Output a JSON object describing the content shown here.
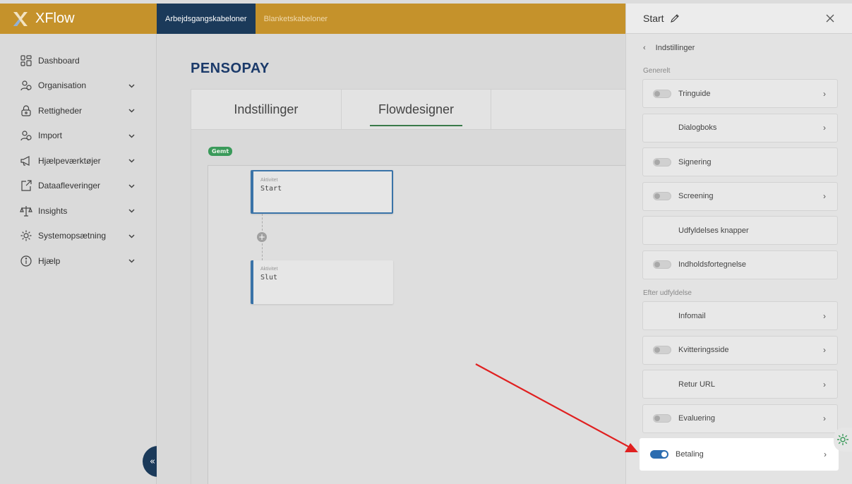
{
  "brand": {
    "name": "XFlow"
  },
  "topbar": {
    "tabs": [
      {
        "label": "Arbejdsgangskabeloner",
        "active": true
      },
      {
        "label": "Blanketskabeloner",
        "active": false
      }
    ]
  },
  "sidebar": {
    "items": [
      {
        "label": "Dashboard",
        "icon": "grid-icon",
        "has_chevron": false
      },
      {
        "label": "Organisation",
        "icon": "users-icon",
        "has_chevron": true
      },
      {
        "label": "Rettigheder",
        "icon": "lock-icon",
        "has_chevron": true
      },
      {
        "label": "Import",
        "icon": "users-icon",
        "has_chevron": true
      },
      {
        "label": "Hjælpeværktøjer",
        "icon": "megaphone-icon",
        "has_chevron": true
      },
      {
        "label": "Dataafleveringer",
        "icon": "export-icon",
        "has_chevron": true
      },
      {
        "label": "Insights",
        "icon": "scale-icon",
        "has_chevron": true
      },
      {
        "label": "Systemopsætning",
        "icon": "gear-icon",
        "has_chevron": true
      },
      {
        "label": "Hjælp",
        "icon": "info-icon",
        "has_chevron": true
      }
    ],
    "collapse_symbol": "«"
  },
  "main": {
    "title": "PENSOPAY",
    "tabs": [
      {
        "label": "Indstillinger",
        "active": false
      },
      {
        "label": "Flowdesigner",
        "active": true
      }
    ],
    "saved_badge": "Gemt",
    "nodes": [
      {
        "type": "Aktivitet",
        "name": "Start",
        "selected": true
      },
      {
        "type": "Aktivitet",
        "name": "Slut",
        "selected": false
      }
    ],
    "add_symbol": "+"
  },
  "panel": {
    "title": "Start",
    "back_label": "Indstillinger",
    "sections": [
      {
        "label": "Generelt",
        "rows": [
          {
            "label": "Tringuide",
            "toggle": "off",
            "chevron": true
          },
          {
            "label": "Dialogboks",
            "toggle": "none",
            "chevron": true
          },
          {
            "label": "Signering",
            "toggle": "off",
            "chevron": false
          },
          {
            "label": "Screening",
            "toggle": "off",
            "chevron": true
          },
          {
            "label": "Udfyldelses knapper",
            "toggle": "none",
            "chevron": false
          },
          {
            "label": "Indholdsfortegnelse",
            "toggle": "off",
            "chevron": false
          }
        ]
      },
      {
        "label": "Efter udfyldelse",
        "rows": [
          {
            "label": "Infomail",
            "toggle": "none",
            "chevron": true
          },
          {
            "label": "Kvitteringsside",
            "toggle": "off",
            "chevron": true
          },
          {
            "label": "Retur URL",
            "toggle": "none",
            "chevron": true
          },
          {
            "label": "Evaluering",
            "toggle": "off",
            "chevron": true
          },
          {
            "label": "Betaling",
            "toggle": "on",
            "chevron": true,
            "highlighted": true
          }
        ]
      }
    ]
  },
  "colors": {
    "brand": "#c5922b",
    "navy": "#1b3a5a",
    "toggle_on": "#2b6cb0",
    "annotation": "#e02020"
  }
}
